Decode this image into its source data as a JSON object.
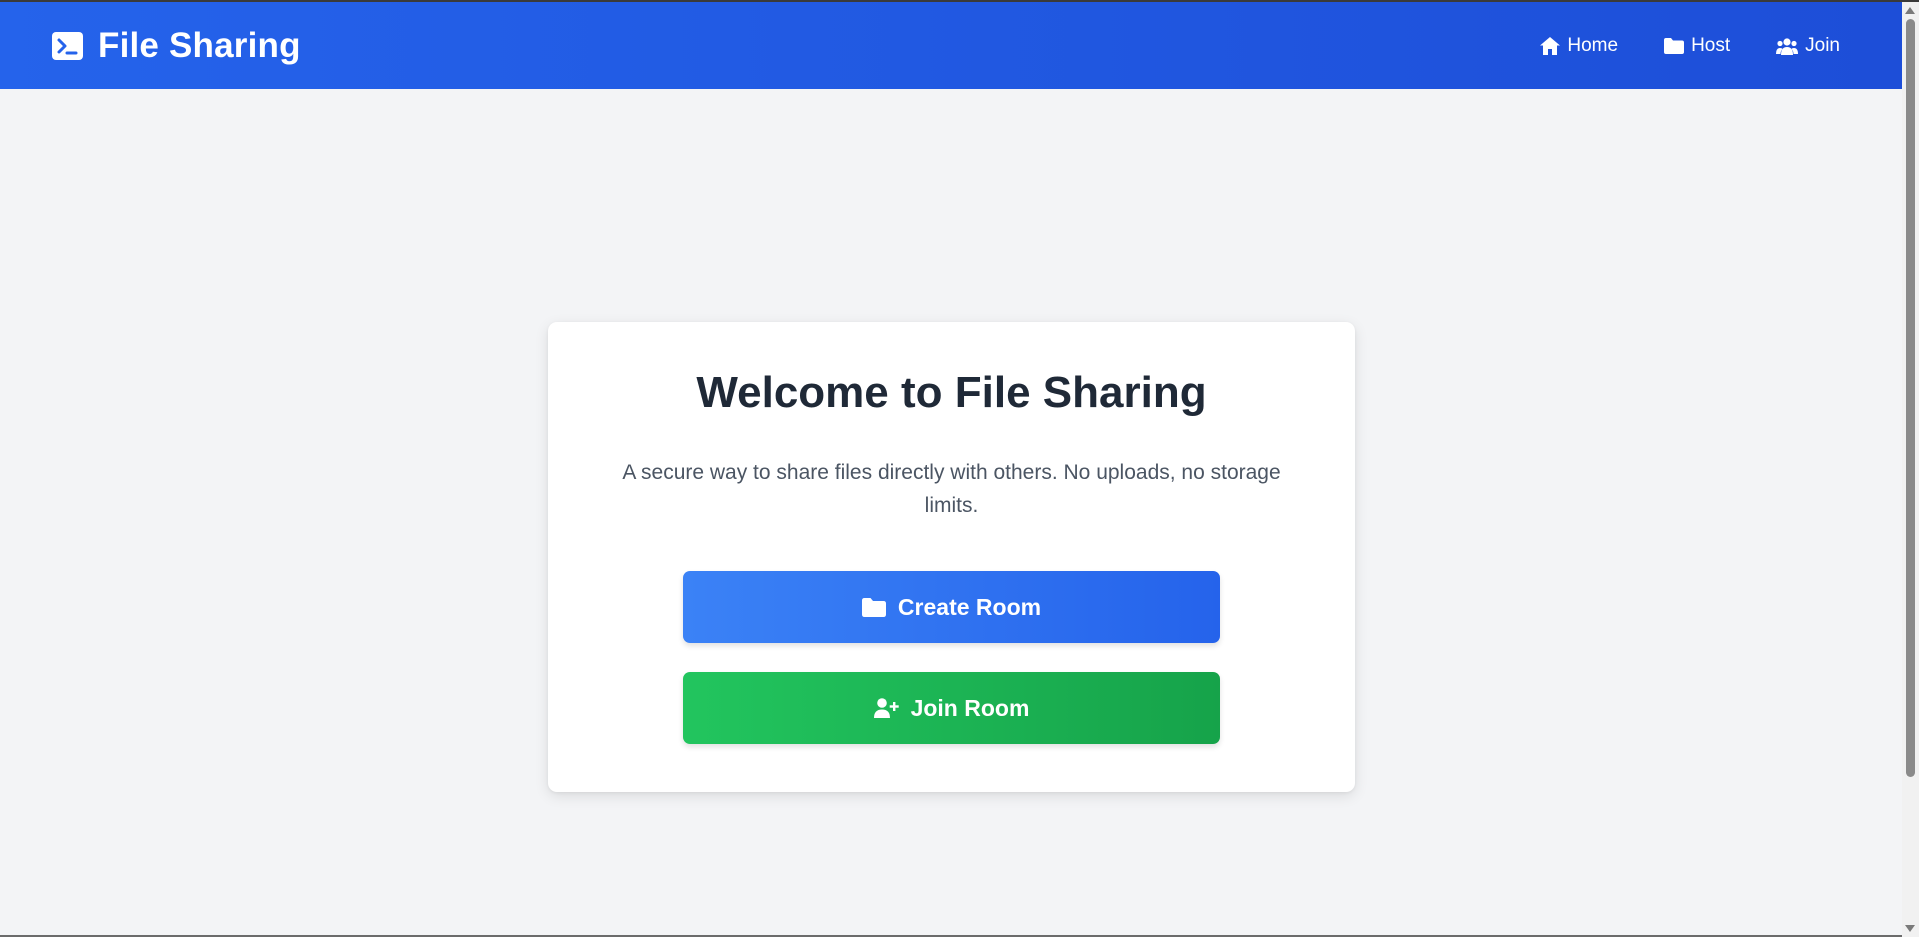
{
  "navbar": {
    "brand": {
      "icon": "terminal-icon",
      "title": "File Sharing"
    },
    "links": [
      {
        "label": "Home",
        "icon": "home-icon"
      },
      {
        "label": "Host",
        "icon": "folder-icon"
      },
      {
        "label": "Join",
        "icon": "users-icon"
      }
    ]
  },
  "main": {
    "title": "Welcome to File Sharing",
    "description": "A secure way to share files directly with others. No uploads, no storage limits.",
    "create_button": {
      "label": "Create Room",
      "icon": "folder-icon"
    },
    "join_button": {
      "label": "Join Room",
      "icon": "user-plus-icon"
    }
  },
  "colors": {
    "navbar": "#2563eb",
    "primary_button": "#3b82f6",
    "success_button": "#22c55e",
    "background": "#f3f4f6",
    "title_text": "#1f2937",
    "body_text": "#4b5563"
  }
}
